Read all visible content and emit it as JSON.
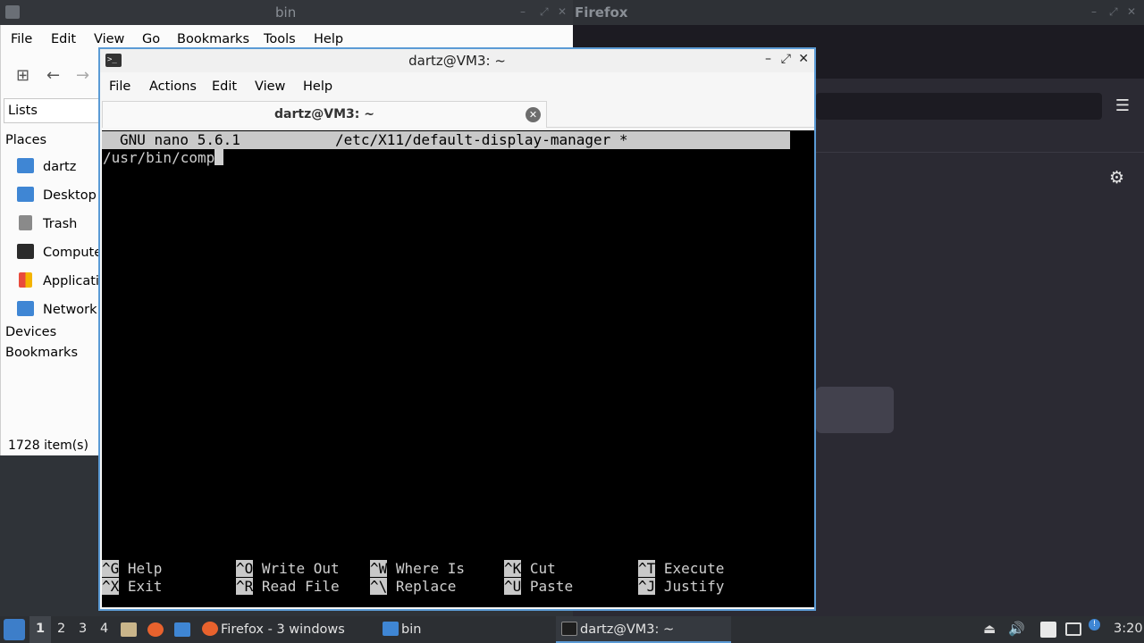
{
  "colors": {
    "accent": "#5b9bd5",
    "terminal_bg": "#000000",
    "nano_bar": "#c9c9c9",
    "taskbar": "#2c2f33"
  },
  "file_manager": {
    "title": "bin",
    "menu": [
      "File",
      "Edit",
      "View",
      "Go",
      "Bookmarks",
      "Tools",
      "Help"
    ],
    "lists_label": "Lists",
    "places_heading": "Places",
    "places": [
      {
        "label": "dartz",
        "icon": "home-folder-icon"
      },
      {
        "label": "Desktop",
        "icon": "desktop-icon"
      },
      {
        "label": "Trash",
        "icon": "trash-icon"
      },
      {
        "label": "Compute",
        "icon": "computer-icon"
      },
      {
        "label": "Applicati",
        "icon": "applications-icon"
      },
      {
        "label": "Network",
        "icon": "network-icon"
      }
    ],
    "devices_heading": "Devices",
    "bookmarks_heading": "Bookmarks",
    "status": "1728 item(s)"
  },
  "firefox": {
    "title": "Firefox"
  },
  "terminal": {
    "title": "dartz@VM3: ~",
    "menu": [
      "File",
      "Actions",
      "Edit",
      "View",
      "Help"
    ],
    "tab_label": "dartz@VM3: ~",
    "nano": {
      "version": "GNU nano 5.6.1",
      "filename": "/etc/X11/default-display-manager *",
      "content": "/usr/bin/comp",
      "shortcuts": [
        {
          "key": "^G",
          "label": "Help"
        },
        {
          "key": "^O",
          "label": "Write Out"
        },
        {
          "key": "^W",
          "label": "Where Is"
        },
        {
          "key": "^K",
          "label": "Cut"
        },
        {
          "key": "^T",
          "label": "Execute"
        },
        {
          "key": "^X",
          "label": "Exit"
        },
        {
          "key": "^R",
          "label": "Read File"
        },
        {
          "key": "^\\",
          "label": "Replace"
        },
        {
          "key": "^U",
          "label": "Paste"
        },
        {
          "key": "^J",
          "label": "Justify"
        }
      ]
    }
  },
  "taskbar": {
    "workspaces": [
      "1",
      "2",
      "3",
      "4"
    ],
    "tasks": [
      {
        "label": "Firefox - 3 windows"
      },
      {
        "label": "bin"
      },
      {
        "label": "dartz@VM3: ~"
      }
    ],
    "clock": "3:20"
  }
}
